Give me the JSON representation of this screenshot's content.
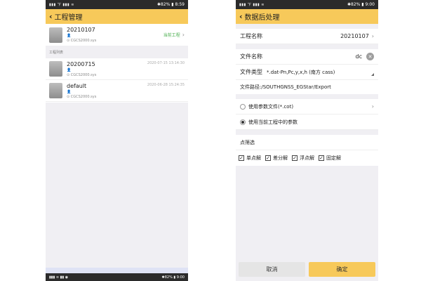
{
  "left": {
    "status": {
      "signal": "▮▮▮ 㓀 ▮▮▮ ≋",
      "battery": "✱82% ▮",
      "time": "8:59"
    },
    "title": "工程管理",
    "current_project": {
      "name": "20210107",
      "coord": "CGCS2000.sys",
      "tag": "当前工程"
    },
    "section_label": "工程列表",
    "projects": [
      {
        "name": "20200715",
        "coord": "CGCS2000.sys",
        "time": "2020-07-15 13:14:30"
      },
      {
        "name": "default",
        "coord": "CGCS2000.sys",
        "time": "2020-06-28 15:24:35"
      }
    ],
    "navbar": {
      "signal": "▮▮▮ ≋ ▮▮ ◉",
      "battery": "✱82% ▮ 9:00"
    }
  },
  "right": {
    "status": {
      "signal": "▮▮▮ 㓀 ▮▮▮ ≋",
      "battery": "✱82% ▮",
      "time": "9:00"
    },
    "title": "数据后处理",
    "project_label": "工程名称",
    "project_value": "20210107",
    "filename_label": "文件名称",
    "filename_value": "dc",
    "filetype_label": "文件类型",
    "filetype_value": "*.dat-Pn,Pc,y,x,h (南方 cass)",
    "path": "文件路径:/SOUTHGNSS_EGStar/Export",
    "options": [
      {
        "label": "使用参数文件(*.cot)",
        "selected": false
      },
      {
        "label": "使用当前工程中的参数",
        "selected": true
      }
    ],
    "filter_title": "点筛选",
    "checks": [
      "单点解",
      "差分解",
      "浮点解",
      "固定解"
    ],
    "cancel_label": "取消",
    "ok_label": "确定"
  }
}
